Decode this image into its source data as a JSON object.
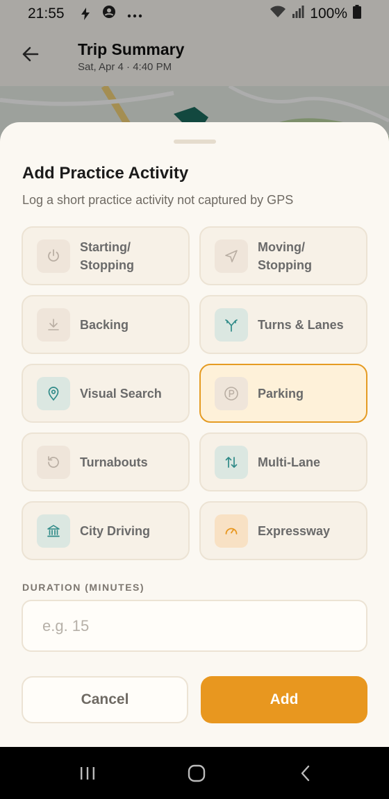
{
  "status_bar": {
    "time": "21:55",
    "battery": "100%",
    "icons": [
      "flash-icon",
      "account-circle-icon",
      "more-dots-icon",
      "wifi-icon",
      "signal-icon",
      "battery-icon"
    ]
  },
  "app_bar": {
    "title": "Trip Summary",
    "subtitle": "Sat, Apr 4 · 4:40 PM",
    "back_icon": "arrow-left-icon"
  },
  "sheet": {
    "title": "Add Practice Activity",
    "subtitle": "Log a short practice activity not captured by GPS",
    "activities": [
      {
        "label": "Starting/\nStopping",
        "icon": "power-icon",
        "tint": "neutral",
        "selected": false
      },
      {
        "label": "Moving/\nStopping",
        "icon": "navigation-arrow-icon",
        "tint": "neutral",
        "selected": false
      },
      {
        "label": "Backing",
        "icon": "download-arrow-icon",
        "tint": "neutral",
        "selected": false
      },
      {
        "label": "Turns & Lanes",
        "icon": "split-arrows-icon",
        "tint": "teal",
        "selected": false
      },
      {
        "label": "Visual Search",
        "icon": "map-pin-icon",
        "tint": "teal",
        "selected": false
      },
      {
        "label": "Parking",
        "icon": "parking-icon",
        "tint": "neutral",
        "selected": true
      },
      {
        "label": "Turnabouts",
        "icon": "rotate-ccw-icon",
        "tint": "neutral",
        "selected": false
      },
      {
        "label": "Multi-Lane",
        "icon": "up-down-arrows-icon",
        "tint": "teal",
        "selected": false
      },
      {
        "label": "City Driving",
        "icon": "landmark-icon",
        "tint": "teal",
        "selected": false
      },
      {
        "label": "Expressway",
        "icon": "gauge-icon",
        "tint": "amber",
        "selected": false
      }
    ],
    "duration_label": "DURATION (MINUTES)",
    "duration_value": "",
    "duration_placeholder": "e.g. 15",
    "cancel_label": "Cancel",
    "add_label": "Add"
  },
  "colors": {
    "accent": "#e8971f",
    "teal_icon": "#2f8a88",
    "muted_icon": "#b9aea3",
    "sheet_bg": "#fbf8f2",
    "tile_bg": "#f7f1e7",
    "selected_bg": "#fef1d9"
  },
  "nav_bar": {
    "icons": [
      "recents-icon",
      "home-icon",
      "back-icon"
    ]
  }
}
